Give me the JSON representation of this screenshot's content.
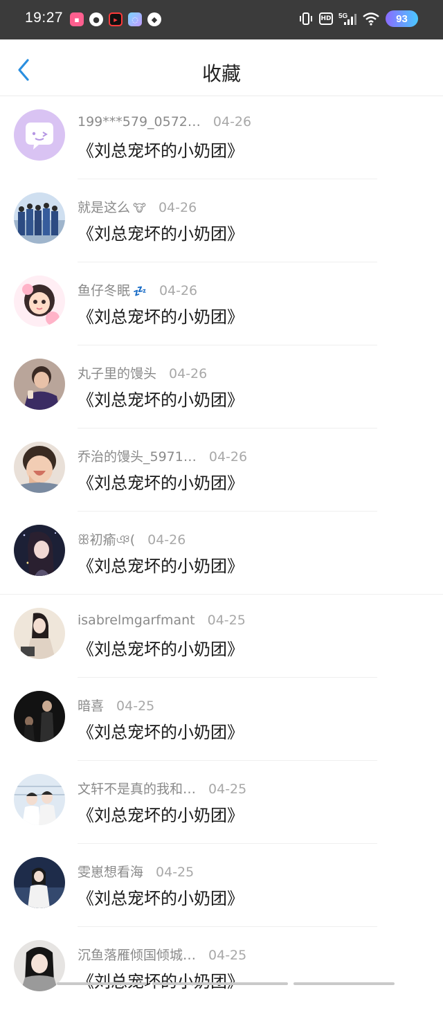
{
  "status_bar": {
    "time": "19:27",
    "battery": "93",
    "network": "5G",
    "hd": "HD"
  },
  "header": {
    "title": "收藏"
  },
  "items": [
    {
      "user": "199***579_0572…",
      "date": "04-26",
      "title": "《刘总宠坏的小奶团》"
    },
    {
      "user": "就是这么",
      "emoji": "🐮",
      "date": "04-26",
      "title": "《刘总宠坏的小奶团》"
    },
    {
      "user": "鱼仔冬眠",
      "emoji": "💤",
      "date": "04-26",
      "title": "《刘总宠坏的小奶团》"
    },
    {
      "user": "丸子里的馒头",
      "date": "04-26",
      "title": "《刘总宠坏的小奶团》"
    },
    {
      "user": "乔治的馒头_5971…",
      "date": "04-26",
      "title": "《刘总宠坏的小奶团》"
    },
    {
      "user": "ꕥ初瘉ঞ(",
      "date": "04-26",
      "title": "《刘总宠坏的小奶团》"
    },
    {
      "user": "isabrelmgarfmant",
      "date": "04-25",
      "title": "《刘总宠坏的小奶团》"
    },
    {
      "user": "暗喜",
      "date": "04-25",
      "title": "《刘总宠坏的小奶团》"
    },
    {
      "user": "文轩不是真的我和…",
      "date": "04-25",
      "title": "《刘总宠坏的小奶团》"
    },
    {
      "user": "雯崽想看海",
      "date": "04-25",
      "title": "《刘总宠坏的小奶团》"
    },
    {
      "user": "沉鱼落雁倾国倾城…",
      "date": "04-25",
      "title": "《刘总宠坏的小奶团》"
    }
  ]
}
